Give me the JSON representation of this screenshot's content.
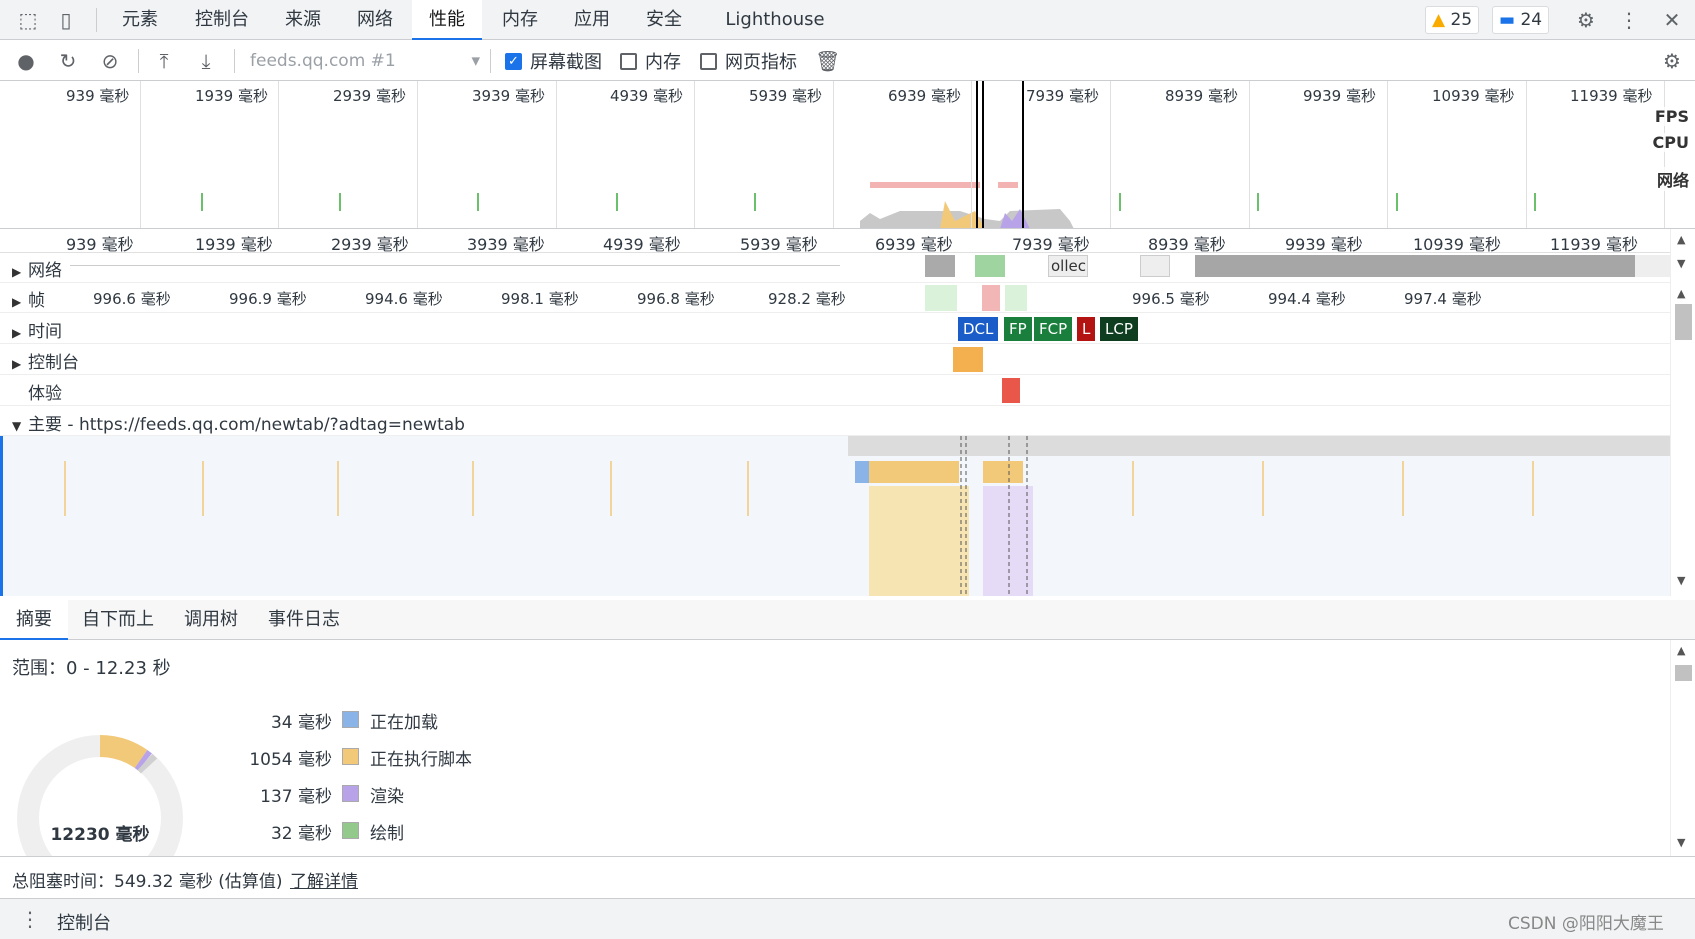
{
  "top_tabs": [
    "元素",
    "控制台",
    "来源",
    "网络",
    "性能",
    "内存",
    "应用",
    "安全",
    "Lighthouse"
  ],
  "active_tab": "性能",
  "badges": {
    "warnings": "25",
    "messages": "24"
  },
  "toolbar": {
    "recording_select": "feeds.qq.com #1",
    "screenshots_label": "屏幕截图",
    "memory_label": "内存",
    "webvitals_label": "网页指标"
  },
  "overview": {
    "ticks": [
      "939 毫秒",
      "1939 毫秒",
      "2939 毫秒",
      "3939 毫秒",
      "4939 毫秒",
      "5939 毫秒",
      "6939 毫秒",
      "7939 毫秒",
      "8939 毫秒",
      "9939 毫秒",
      "10939 毫秒",
      "11939 毫秒"
    ],
    "fps_label": "FPS",
    "cpu_label": "CPU",
    "net_label": "网络"
  },
  "ruler": {
    "ticks": [
      "939 毫秒",
      "1939 毫秒",
      "2939 毫秒",
      "3939 毫秒",
      "4939 毫秒",
      "5939 毫秒",
      "6939 毫秒",
      "7939 毫秒",
      "8939 毫秒",
      "9939 毫秒",
      "10939 毫秒",
      "11939 毫秒"
    ]
  },
  "tracks": {
    "network": "网络",
    "network_snippet": "ollec",
    "frames": "帧",
    "frame_values": [
      "996.6 毫秒",
      "996.9 毫秒",
      "994.6 毫秒",
      "998.1 毫秒",
      "996.8 毫秒",
      "928.2 毫秒",
      "996.5 毫秒",
      "994.4 毫秒",
      "997.4 毫秒"
    ],
    "timings": "时间",
    "markers": [
      "DCL",
      "FP",
      "FCP",
      "L",
      "LCP"
    ],
    "console": "控制台",
    "experience": "体验",
    "main": "主要 - https://feeds.qq.com/newtab/?adtag=newtab"
  },
  "bottom_tabs": [
    "摘要",
    "自下而上",
    "调用树",
    "事件日志"
  ],
  "summary": {
    "range": "范围：0 - 12.23 秒",
    "total": "12230 毫秒",
    "items": [
      {
        "value": "34 毫秒",
        "name": "正在加载",
        "color": "#8ab4e8"
      },
      {
        "value": "1054 毫秒",
        "name": "正在执行脚本",
        "color": "#f2c978"
      },
      {
        "value": "137 毫秒",
        "name": "渲染",
        "color": "#b8a3e8"
      },
      {
        "value": "32 毫秒",
        "name": "绘制",
        "color": "#94c98c"
      }
    ]
  },
  "footer": {
    "text": "总阻塞时间：549.32 毫秒 (估算值)",
    "link": "了解详情"
  },
  "drawer": {
    "label": "控制台"
  },
  "watermark": "CSDN @阳阳大魔王"
}
